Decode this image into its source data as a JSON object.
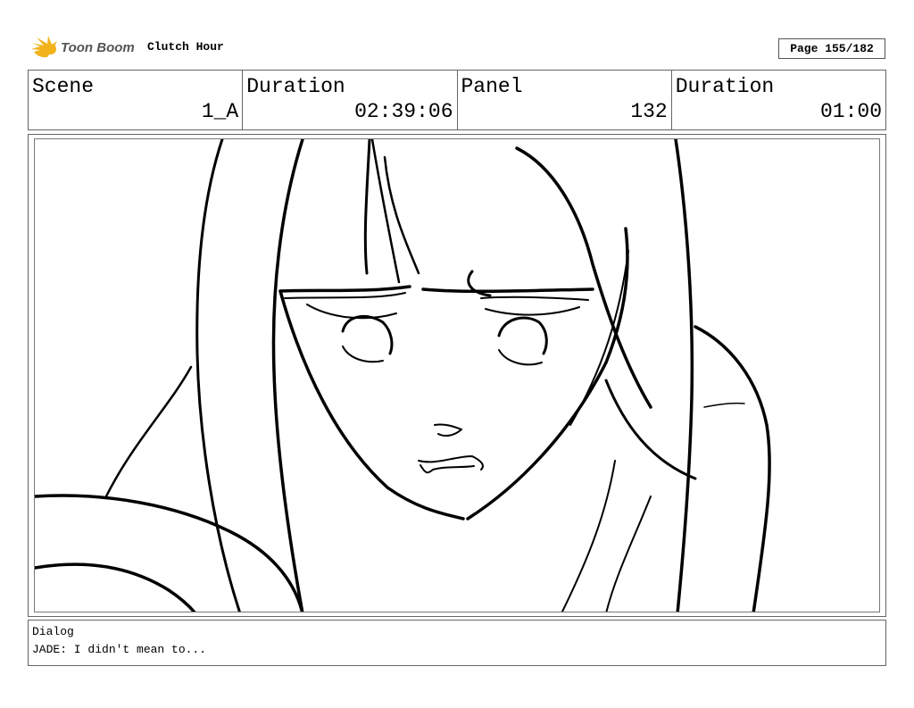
{
  "header": {
    "logo_text": "Toon Boom",
    "project_title": "Clutch Hour",
    "page_indicator": "Page 155/182"
  },
  "info": {
    "scene_label": "Scene",
    "scene_value": "1_A",
    "scene_duration_label": "Duration",
    "scene_duration_value": "02:39:06",
    "panel_label": "Panel",
    "panel_value": "132",
    "panel_duration_label": "Duration",
    "panel_duration_value": "01:00"
  },
  "dialog": {
    "label": "Dialog",
    "text": "JADE: I didn't mean to..."
  },
  "colors": {
    "logo_accent": "#f2b21b",
    "logo_text": "#555555",
    "ink": "#000000"
  }
}
